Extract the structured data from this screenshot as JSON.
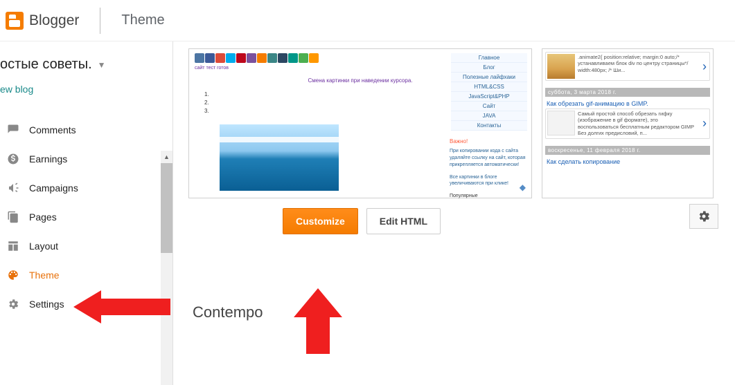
{
  "brand": "Blogger",
  "page_title": "Theme",
  "blog_select": {
    "name": "остые советы.",
    "view_blog": "ew blog"
  },
  "nav": {
    "comments": "Comments",
    "earnings": "Earnings",
    "campaigns": "Campaigns",
    "pages": "Pages",
    "layout": "Layout",
    "theme": "Theme",
    "settings": "Settings"
  },
  "preview_left": {
    "sub": "сайт тест готов",
    "headline": "Смена картинки при наведении курсора.",
    "list": {
      "l1": "1.",
      "l2": "2.",
      "l3": "3."
    },
    "social_colors": [
      "#4c75a3",
      "#3b5998",
      "#dd4b39",
      "#00aced",
      "#bd081c",
      "#7b519d",
      "#f57c00",
      "#3b8686",
      "#2c4762",
      "#009688",
      "#4caf50",
      "#ff9800"
    ],
    "right_menu": {
      "a": "Главное",
      "b": "Блог",
      "c": "Полезные лайфхаки",
      "d": "HTML&CSS",
      "e": "JavaScript&PHP",
      "f": "Сайт",
      "g": "JAVA",
      "h": "Контакты"
    },
    "right_sub": {
      "warn": "Важно!",
      "t1": "При копировании кода с сайта удаляйте ссылку на сайт, которая прикрепляется автоматически!",
      "t2": "Все картинки в блоге увеличиваются при клике!",
      "pop": "Популярные"
    }
  },
  "preview_right": {
    "post1": {
      "text": ".animate2{ position:relative; margin:0 auto;/* устанавливаем блок div по центру страницы*/ width:480px; /* Ши..."
    },
    "post2": {
      "date": "суббота, 3 марта 2018 г.",
      "title": "Как обрезать gif-анимацию в GIMP.",
      "text": "Самый простой способ обрезать гифку (изображение в gif формате), это воспользоваться бесплатным редактором GIMP Без долгих предисловий, п..."
    },
    "post3": {
      "date": "воскресенье, 11 февраля 2018 г.",
      "title": "Как сделать копирование"
    }
  },
  "buttons": {
    "customize": "Customize",
    "edit_html": "Edit HTML"
  },
  "section_title": "Contempo"
}
